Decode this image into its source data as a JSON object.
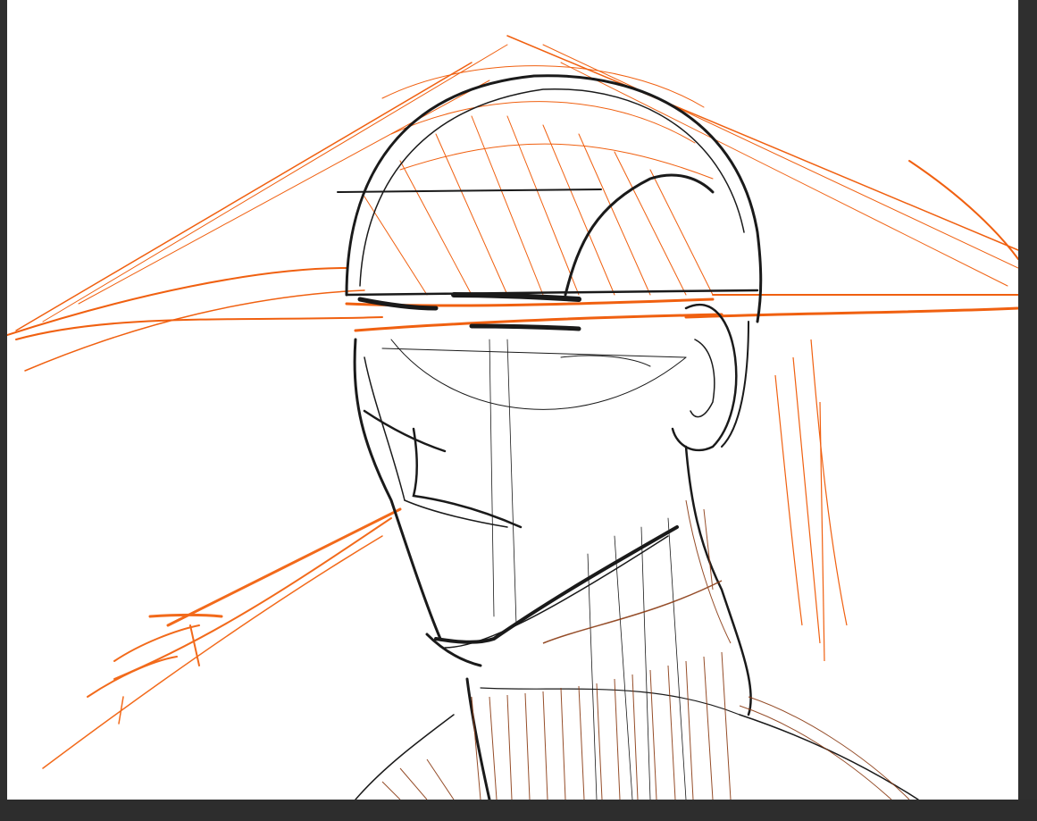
{
  "app": {
    "kind": "drawing-canvas",
    "background_color": "#2b2b2b",
    "canvas_color": "#ffffff"
  },
  "artwork": {
    "subject": "sketch-portrait",
    "stroke_colors": {
      "outline": "#1a1a1a",
      "hat": "#f06010",
      "hair_tail": "#f26a1b",
      "neck_shading": "#8a3a12"
    }
  }
}
